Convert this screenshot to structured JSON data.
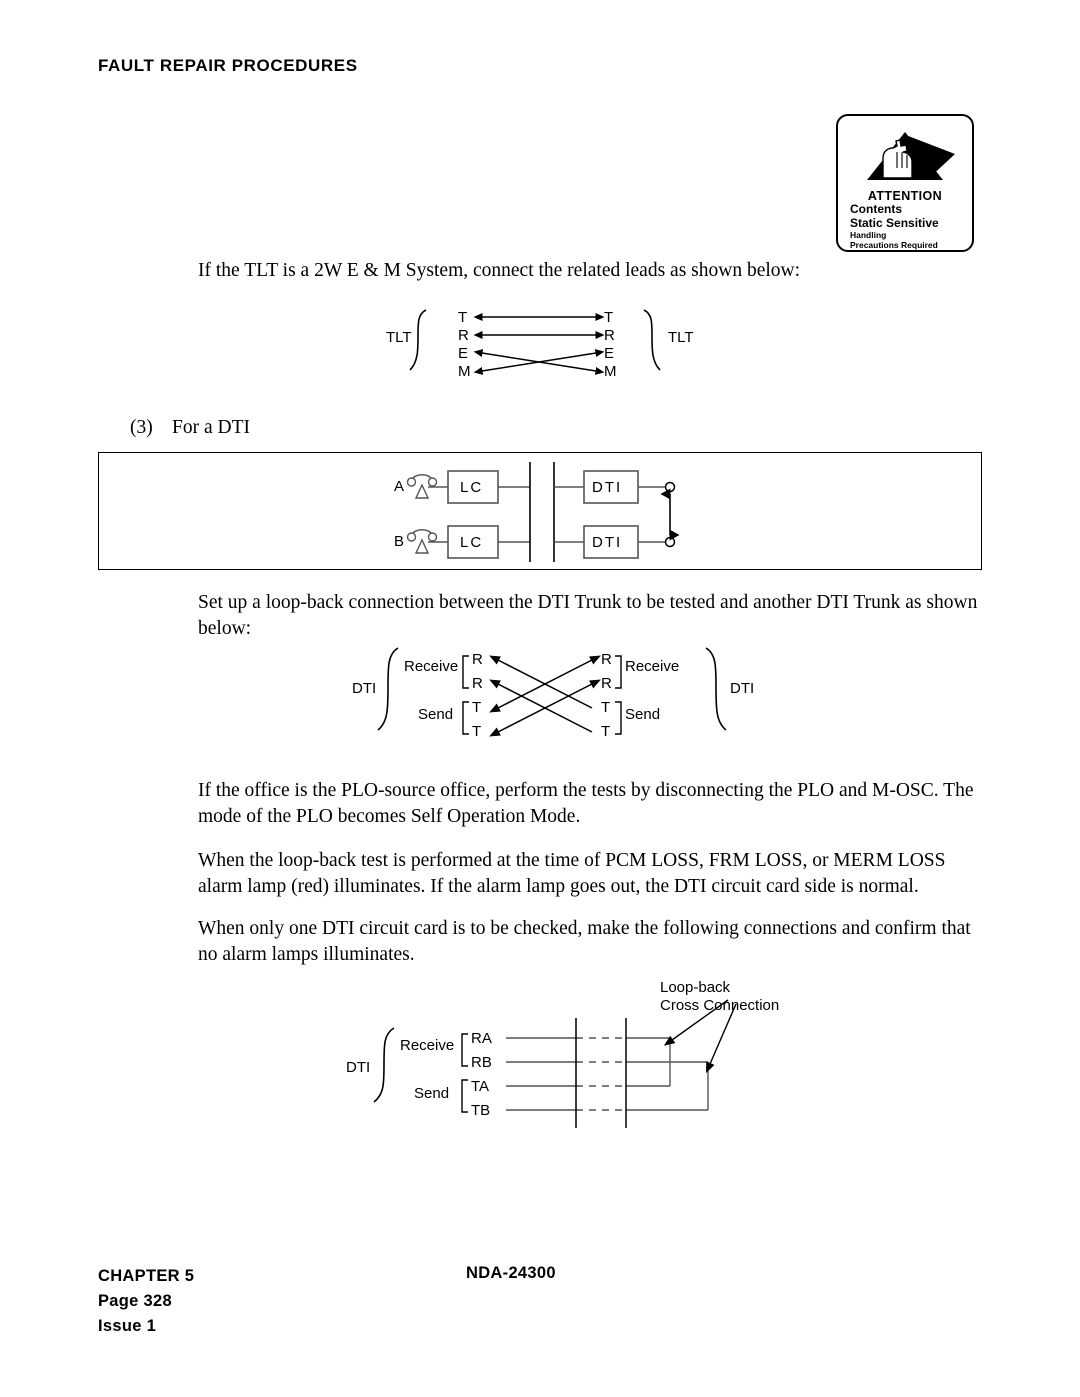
{
  "header": {
    "running_head": "FAULT REPAIR PROCEDURES"
  },
  "esd_label": {
    "icon": "esd-hand-triangle-icon",
    "line1": "ATTENTION",
    "line2": "Contents",
    "line3": "Static Sensitive",
    "line4": "Handling",
    "line5": "Precautions Required"
  },
  "content": {
    "para_tlt": "If the TLT is a 2W E & M System, connect the related leads as shown below:",
    "item3_number": "(3)",
    "item3_text": "For a DTI",
    "para_loopback": "Set up a loop-back connection between the DTI Trunk to be tested and another DTI Trunk as shown below:",
    "para_plo": "If the office is the PLO-source office, perform the tests by disconnecting the PLO and M-OSC. The mode of the PLO becomes Self Operation Mode.",
    "para_alarm": "When the loop-back test is performed at the time of PCM LOSS, FRM LOSS, or MERM LOSS alarm lamp (red) illuminates. If the alarm lamp goes out, the DTI circuit card side is normal.",
    "para_single_card": "When only one DTI circuit card is to be checked, make the following connections and confirm that no alarm lamps illuminates."
  },
  "tlt_diagram": {
    "left_label": "TLT",
    "right_label": "TLT",
    "left_leads": [
      "T",
      "R",
      "E",
      "M"
    ],
    "right_leads": [
      "T",
      "R",
      "E",
      "M"
    ],
    "connections": [
      "T-T straight",
      "R-R straight",
      "E-M crossed",
      "M-E crossed"
    ]
  },
  "dti_box_diagram": {
    "station_a_label": "A",
    "station_b_label": "B",
    "lc_label_a": "LC",
    "lc_label_b": "LC",
    "dti_label_a": "DTI",
    "dti_label_b": "DTI",
    "phone_icon": "telephone-set-icon",
    "terminal_icon": "terminal-circle-icon",
    "link_icon": "double-arrow-vertical-icon"
  },
  "dti_loopback_diagram": {
    "left_label": "DTI",
    "right_label": "DTI",
    "left_receive_label": "Receive",
    "left_send_label": "Send",
    "right_receive_label": "Receive",
    "right_send_label": "Send",
    "left_receive_leads": [
      "R",
      "R"
    ],
    "left_send_leads": [
      "T",
      "T"
    ],
    "right_receive_leads": [
      "R",
      "R"
    ],
    "right_send_leads": [
      "T",
      "T"
    ]
  },
  "dti_crossconnect_diagram": {
    "left_label": "DTI",
    "receive_label": "Receive",
    "send_label": "Send",
    "receive_leads": [
      "RA",
      "RB"
    ],
    "send_leads": [
      "TA",
      "TB"
    ],
    "callout_line1": "Loop-back",
    "callout_line2": "Cross Connection"
  },
  "footer": {
    "chapter": "CHAPTER 5",
    "page": "Page 328",
    "issue": "Issue 1",
    "doc_number": "NDA-24300"
  }
}
